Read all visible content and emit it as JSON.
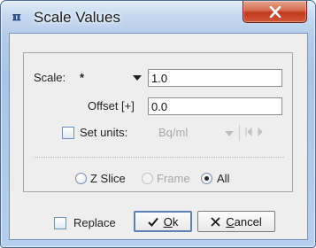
{
  "window": {
    "title": "Scale Values",
    "icon": "pmod-logo-icon",
    "close_label": "X"
  },
  "form": {
    "scale_label": "Scale:",
    "scale_operator": "*",
    "scale_value": "1.0",
    "offset_label": "Offset [+]",
    "offset_value": "0.0",
    "set_units_label": "Set units:",
    "set_units_checked": false,
    "units_value": "Bq/ml"
  },
  "apply_to": {
    "options": [
      {
        "label": "Z Slice",
        "selected": false,
        "enabled": true
      },
      {
        "label": "Frame",
        "selected": false,
        "enabled": false
      },
      {
        "label": "All",
        "selected": true,
        "enabled": true
      }
    ]
  },
  "footer": {
    "replace_label": "Replace",
    "replace_checked": false,
    "ok_label": "k",
    "ok_mnemonic": "O",
    "cancel_label": "ancel",
    "cancel_mnemonic": "C"
  },
  "colors": {
    "title_bar": "#b5cde9",
    "close_button": "#c0391f",
    "dialog_bg": "#eeeeee",
    "default_button_border": "#5d7fb3"
  }
}
